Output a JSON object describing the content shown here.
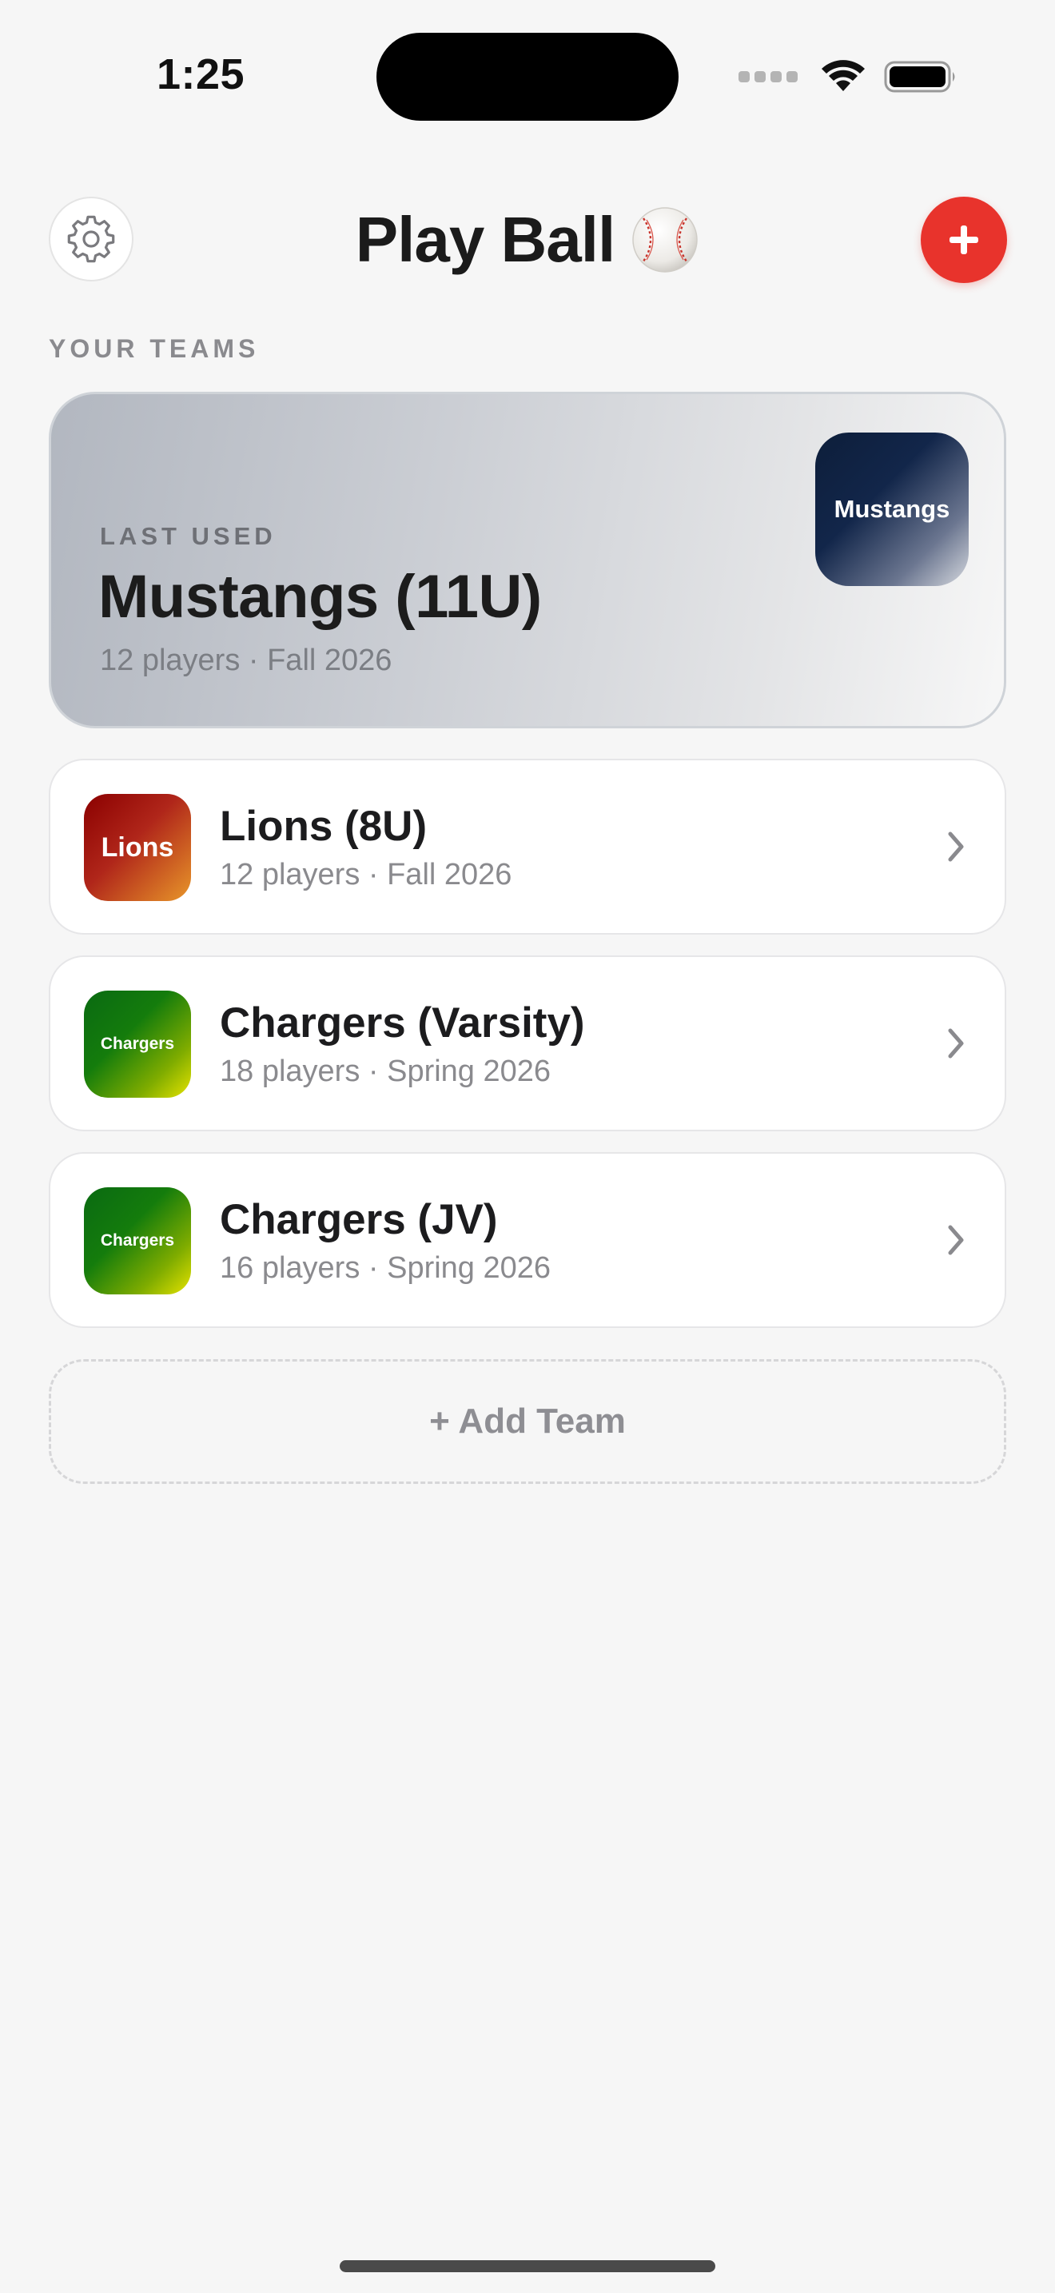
{
  "status_bar": {
    "time": "1:25"
  },
  "header": {
    "title": "Play Ball",
    "title_emoji": "⚾",
    "settings_icon": "gear-icon",
    "add_icon": "plus-icon"
  },
  "section_label": "YOUR TEAMS",
  "featured": {
    "label": "LAST USED",
    "name": "Mustangs (11U)",
    "meta": "12 players · Fall 2026",
    "logo_text": "Mustangs"
  },
  "teams": [
    {
      "name": "Lions (8U)",
      "meta": "12 players · Fall 2026",
      "logo_text": "Lions"
    },
    {
      "name": "Chargers (Varsity)",
      "meta": "18 players · Spring 2026",
      "logo_text": "Chargers"
    },
    {
      "name": "Chargers (JV)",
      "meta": "16 players · Spring 2026",
      "logo_text": "Chargers"
    }
  ],
  "add_team_label": "+ Add Team",
  "colors": {
    "accent": "#e8332c",
    "background": "#f6f6f6"
  }
}
